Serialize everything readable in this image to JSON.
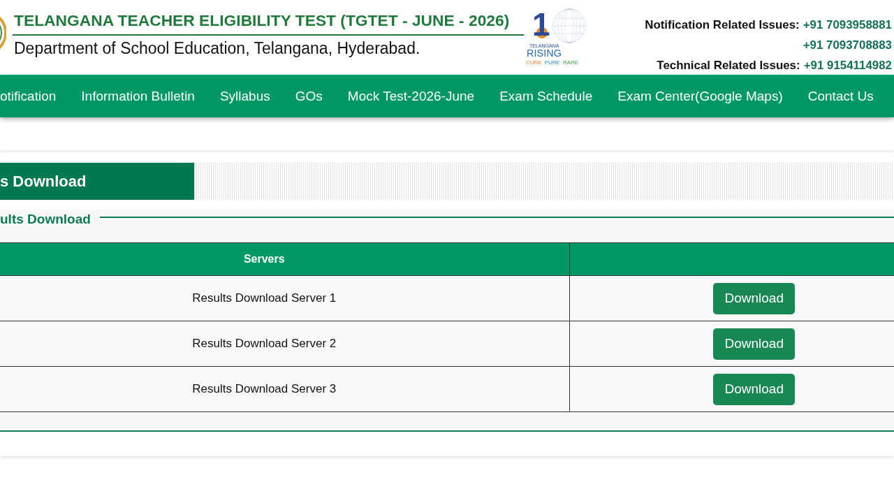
{
  "header": {
    "title": "TELANGANA TEACHER ELIGIBILITY TEST (TGTET - JUNE - 2026)",
    "subtitle": "Department of School Education, Telangana, Hyderabad.",
    "logo": {
      "numeral": "1",
      "top_text": "TELANGANA",
      "name": "RISING",
      "tagline": [
        "CURE",
        "PURE",
        "RARE"
      ]
    },
    "contacts": [
      {
        "label": "Notification Related Issues:",
        "phone": "+91 7093958881"
      },
      {
        "phone": "+91 7093708883"
      },
      {
        "label": "Technical Related Issues:",
        "phone": "+91 9154114982"
      }
    ]
  },
  "nav": {
    "items": [
      "otification",
      "Information Bulletin",
      "Syllabus",
      "GOs",
      "Mock Test-2026-June",
      "Exam Schedule",
      "Exam Center(Google Maps)",
      "Contact Us"
    ]
  },
  "section": {
    "title": "s Download",
    "legend": "ults Download",
    "table": {
      "header": "Servers",
      "rows": [
        {
          "server": "Results Download Server 1",
          "button": "Download"
        },
        {
          "server": "Results Download Server 2",
          "button": "Download"
        },
        {
          "server": "Results Download Server 3",
          "button": "Download"
        }
      ]
    }
  }
}
